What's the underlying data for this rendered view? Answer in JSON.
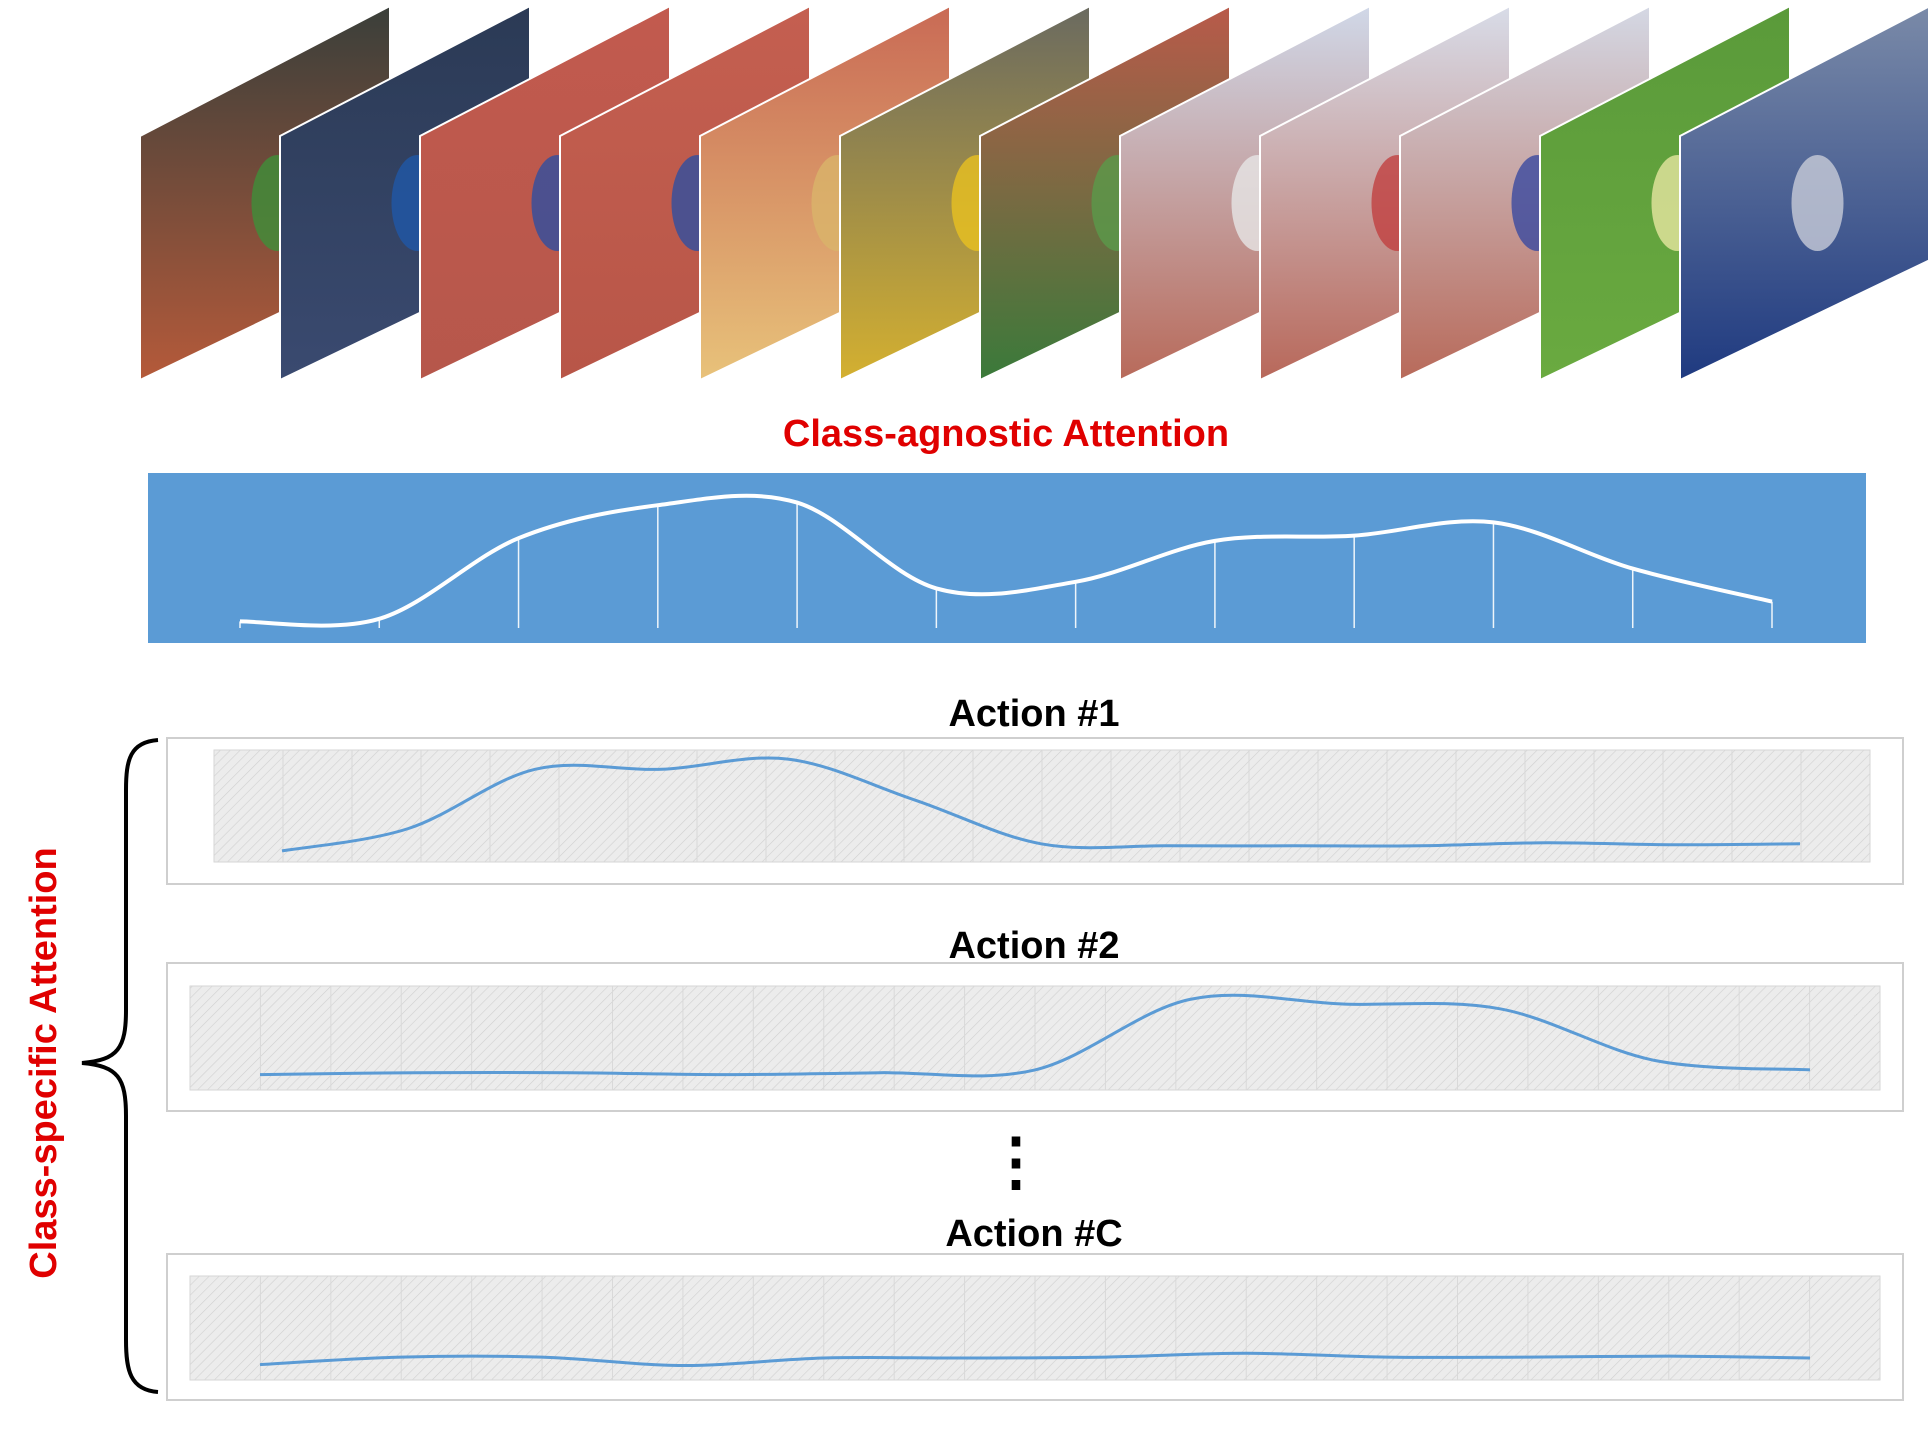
{
  "colors": {
    "agnostic_band": "#5b9bd5",
    "agnostic_curve": "#ffffff",
    "specific_curve": "#5b9bd5",
    "title_red": "#e00000",
    "label_black": "#000000"
  },
  "frames": [
    {
      "name": "frame-stadium-overview",
      "top": "#3a3f3a",
      "bottom": "#b55a3a",
      "accent": "#3f8f3a"
    },
    {
      "name": "frame-athlete-closeup",
      "top": "#2b3a55",
      "bottom": "#3a4a70",
      "accent": "#1f58a8"
    },
    {
      "name": "frame-runway-approach",
      "top": "#c25a4e",
      "bottom": "#b6574b",
      "accent": "#2f4fa0"
    },
    {
      "name": "frame-takeoff",
      "top": "#c45f50",
      "bottom": "#b85648",
      "accent": "#2f4fa0"
    },
    {
      "name": "frame-sand-pit",
      "top": "#c96a55",
      "bottom": "#e8c27a",
      "accent": "#d9b46a"
    },
    {
      "name": "frame-celebration",
      "top": "#6a6a60",
      "bottom": "#d4b030",
      "accent": "#e8c020"
    },
    {
      "name": "frame-track-wide",
      "top": "#b95a4a",
      "bottom": "#3a7a3a",
      "accent": "#5a9a4a"
    },
    {
      "name": "frame-throw-circle",
      "top": "#d0d8e8",
      "bottom": "#b86a5a",
      "accent": "#e6e6e6"
    },
    {
      "name": "frame-thrower-windup",
      "top": "#d8dce8",
      "bottom": "#b8685a",
      "accent": "#c04040"
    },
    {
      "name": "frame-thrower-spin",
      "top": "#d4d8e4",
      "bottom": "#b86a5a",
      "accent": "#3a4aa0"
    },
    {
      "name": "frame-field-grass",
      "top": "#5a9a3a",
      "bottom": "#6aaa40",
      "accent": "#e6e6a0"
    },
    {
      "name": "frame-thrower-closeup",
      "top": "#7a8aa8",
      "bottom": "#1f3a80",
      "accent": "#c8ccd8"
    }
  ],
  "class_agnostic": {
    "title": "Class-agnostic Attention",
    "values": [
      0.05,
      0.07,
      0.68,
      0.93,
      0.95,
      0.3,
      0.35,
      0.66,
      0.7,
      0.8,
      0.45,
      0.2
    ]
  },
  "class_specific": {
    "label": "Class-specific Attention",
    "ellipsis": "⋮",
    "actions": [
      {
        "title": "Action #1",
        "values": [
          0.05,
          0.27,
          0.85,
          0.85,
          0.95,
          0.55,
          0.12,
          0.1,
          0.1,
          0.1,
          0.13,
          0.11,
          0.12
        ]
      },
      {
        "title": "Action #2",
        "values": [
          0.1,
          0.12,
          0.12,
          0.1,
          0.12,
          0.15,
          0.9,
          0.85,
          0.8,
          0.25,
          0.15
        ]
      },
      {
        "title": "Action #C",
        "values": [
          0.1,
          0.18,
          0.18,
          0.09,
          0.17,
          0.17,
          0.18,
          0.22,
          0.18,
          0.18,
          0.19,
          0.17
        ]
      }
    ]
  }
}
